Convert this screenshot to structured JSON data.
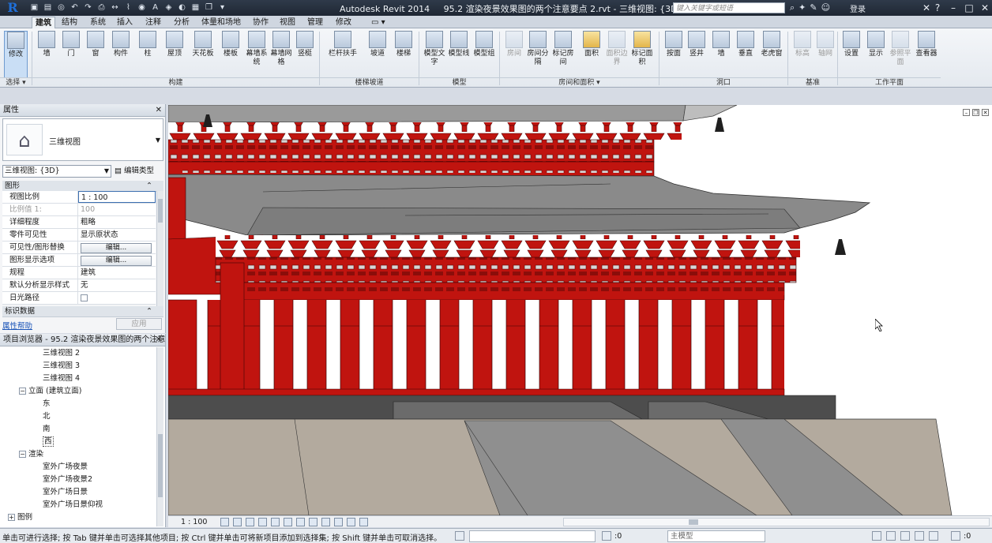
{
  "titlebar": {
    "app_name": "Autodesk Revit 2014",
    "document_title": "95.2 渲染夜景效果图的两个注意要点 2.rvt - 三维视图: {3D}",
    "search_placeholder": "键入关键字或短语",
    "login_label": "登录",
    "logo_letter": "R"
  },
  "tabs": [
    {
      "label": "建筑",
      "active": true
    },
    {
      "label": "结构"
    },
    {
      "label": "系统"
    },
    {
      "label": "插入"
    },
    {
      "label": "注释"
    },
    {
      "label": "分析"
    },
    {
      "label": "体量和场地"
    },
    {
      "label": "协作"
    },
    {
      "label": "视图"
    },
    {
      "label": "管理"
    },
    {
      "label": "修改"
    }
  ],
  "ribbon": {
    "buttons": [
      {
        "label": "修改"
      },
      {
        "label": "墙"
      },
      {
        "label": "门"
      },
      {
        "label": "窗"
      },
      {
        "label": "构件"
      },
      {
        "label": "柱"
      },
      {
        "label": "屋顶"
      },
      {
        "label": "天花板"
      },
      {
        "label": "楼板"
      },
      {
        "label": "幕墙系统"
      },
      {
        "label": "幕墙网格"
      },
      {
        "label": "竖梃"
      },
      {
        "label": "栏杆扶手"
      },
      {
        "label": "坡道"
      },
      {
        "label": "楼梯"
      },
      {
        "label": "模型文字"
      },
      {
        "label": "模型线"
      },
      {
        "label": "模型组"
      },
      {
        "label": "房间"
      },
      {
        "label": "房间分隔"
      },
      {
        "label": "标记房间"
      },
      {
        "label": "面积"
      },
      {
        "label": "面积边界"
      },
      {
        "label": "标记面积"
      },
      {
        "label": "按面"
      },
      {
        "label": "竖井"
      },
      {
        "label": "墙"
      },
      {
        "label": "垂直"
      },
      {
        "label": "老虎窗"
      },
      {
        "label": "标高"
      },
      {
        "label": "轴网"
      },
      {
        "label": "设置"
      },
      {
        "label": "显示"
      },
      {
        "label": "参照平面"
      },
      {
        "label": "查看器"
      }
    ],
    "groups": [
      {
        "label": "选择 ▾"
      },
      {
        "label": "构建"
      },
      {
        "label": "楼梯坡道"
      },
      {
        "label": "模型"
      },
      {
        "label": "房间和面积 ▾"
      },
      {
        "label": "洞口"
      },
      {
        "label": "基准"
      },
      {
        "label": "工作平面"
      }
    ]
  },
  "properties": {
    "title": "属性",
    "type_name": "三维视图",
    "instance_selector": "三维视图: {3D}",
    "edit_type": "编辑类型",
    "section_graphics": "图形",
    "section_identity": "标识数据",
    "rows": [
      {
        "key": "视图比例",
        "value": "1 : 100"
      },
      {
        "key": "比例值 1:",
        "value": "100"
      },
      {
        "key": "详细程度",
        "value": "粗略"
      },
      {
        "key": "零件可见性",
        "value": "显示原状态"
      },
      {
        "key": "可见性/图形替换",
        "value": "编辑..."
      },
      {
        "key": "图形显示选项",
        "value": "编辑..."
      },
      {
        "key": "规程",
        "value": "建筑"
      },
      {
        "key": "默认分析显示样式",
        "value": "无"
      },
      {
        "key": "日光路径",
        "value": ""
      }
    ],
    "help_link": "属性帮助",
    "apply_button": "应用"
  },
  "project_browser": {
    "title": "项目浏览器 - 95.2 渲染夜景效果图的两个注意要点 2.rvt",
    "items": [
      {
        "label": "三维视图 2"
      },
      {
        "label": "三维视图 3"
      },
      {
        "label": "三维视图 4"
      },
      {
        "label": "立面 (建筑立面)"
      },
      {
        "label": "东"
      },
      {
        "label": "北"
      },
      {
        "label": "南"
      },
      {
        "label": "西"
      },
      {
        "label": "渲染"
      },
      {
        "label": "室外广场夜景"
      },
      {
        "label": "室外广场夜景2"
      },
      {
        "label": "室外广场日景"
      },
      {
        "label": "室外广场日景仰视"
      },
      {
        "label": "图例"
      }
    ]
  },
  "view_bar": {
    "scale": "1 : 100"
  },
  "status_bar": {
    "message": "单击可进行选择; 按 Tab 键并单击可选择其他项目; 按 Ctrl 键并单击可将新项目添加到选择集; 按 Shift 键并单击可取消选择。",
    "workset_count": ":0",
    "model_label": "主模型",
    "filter_count": ":0"
  },
  "colors": {
    "column_red": "#c0140f",
    "roof_gray": "#8a8a8a",
    "ground_beige": "#b3aa9e",
    "titlebar": "#2f3a4a"
  }
}
